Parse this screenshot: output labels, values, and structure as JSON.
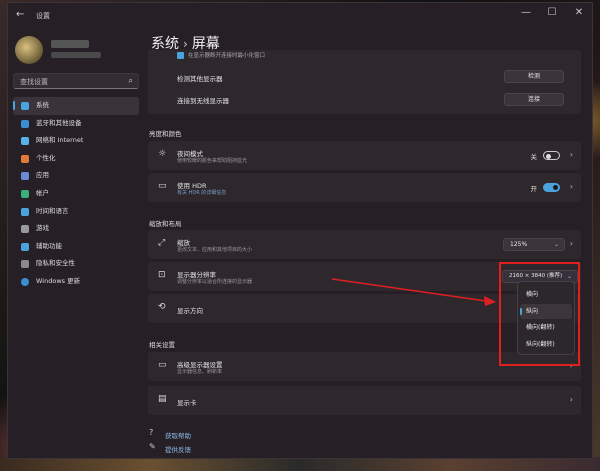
{
  "window": {
    "title": "设置",
    "minimize": "—",
    "maximize": "☐",
    "close": "✕"
  },
  "sidebar": {
    "search_placeholder": "查找设置",
    "items": [
      {
        "label": "系统",
        "color": "#4aa3df",
        "active": true
      },
      {
        "label": "蓝牙和其他设备",
        "color": "#3a8fd0"
      },
      {
        "label": "网络和 Internet",
        "color": "#5ab0e8"
      },
      {
        "label": "个性化",
        "color": "#e07a3a"
      },
      {
        "label": "应用",
        "color": "#6a8ad8"
      },
      {
        "label": "帐户",
        "color": "#3ab07a"
      },
      {
        "label": "时间和语言",
        "color": "#4aa3df"
      },
      {
        "label": "游戏",
        "color": "#9a9a9a"
      },
      {
        "label": "辅助功能",
        "color": "#4aa3df"
      },
      {
        "label": "隐私和安全性",
        "color": "#8a8a8a"
      },
      {
        "label": "Windows 更新",
        "color": "#3a8fd0"
      }
    ]
  },
  "breadcrumb": {
    "parent": "系统",
    "sep": "›",
    "current": "屏幕"
  },
  "top_card": {
    "partial_label": "在显示器断开连接时最小化窗口",
    "rows": [
      {
        "label": "检测其他显示器",
        "button": "检测"
      },
      {
        "label": "连接到无线显示器",
        "button": "连接"
      }
    ]
  },
  "brightness": {
    "heading": "亮度和颜色",
    "night": {
      "label": "夜间模式",
      "sub": "使用较暖的颜色来帮助阻挡蓝光",
      "state": "关"
    },
    "hdr": {
      "label": "使用 HDR",
      "sub": "有关 HDR 的详细信息",
      "state": "开"
    }
  },
  "layout": {
    "heading": "缩放和布局",
    "scale": {
      "label": "缩放",
      "sub": "更改文本、应用和其他项目的大小",
      "value": "125%"
    },
    "resolution": {
      "label": "显示器分辨率",
      "sub": "调整分辨率以适合所连接的显示器",
      "value": "2160 × 3840 (推荐)"
    },
    "orientation": {
      "label": "显示方向"
    }
  },
  "orientation_menu": [
    "横向",
    "纵向",
    "横向(翻转)",
    "纵向(翻转)"
  ],
  "related": {
    "heading": "相关设置",
    "advanced": {
      "label": "高级显示器设置",
      "sub": "显示器信息、刷新率"
    },
    "graphics": {
      "label": "显示卡"
    }
  },
  "links": {
    "help": "获取帮助",
    "feedback": "提供反馈"
  }
}
